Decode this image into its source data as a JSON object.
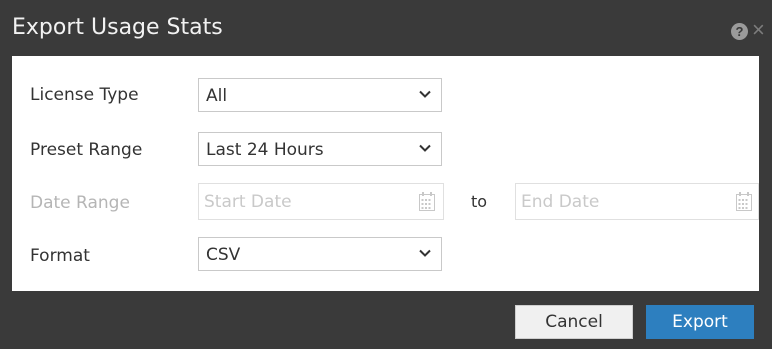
{
  "dialog": {
    "title": "Export Usage Stats",
    "help_icon": "?",
    "close_icon": "×"
  },
  "form": {
    "license_type": {
      "label": "License Type",
      "value": "All"
    },
    "preset_range": {
      "label": "Preset Range",
      "value": "Last 24 Hours"
    },
    "date_range": {
      "label": "Date Range",
      "start_placeholder": "Start Date",
      "separator": "to",
      "end_placeholder": "End Date"
    },
    "format": {
      "label": "Format",
      "value": "CSV"
    }
  },
  "buttons": {
    "cancel": "Cancel",
    "export": "Export"
  },
  "colors": {
    "title_bar": "#3a3a3a",
    "primary": "#2d7fbf",
    "disabled_text": "#b5b5b5"
  }
}
